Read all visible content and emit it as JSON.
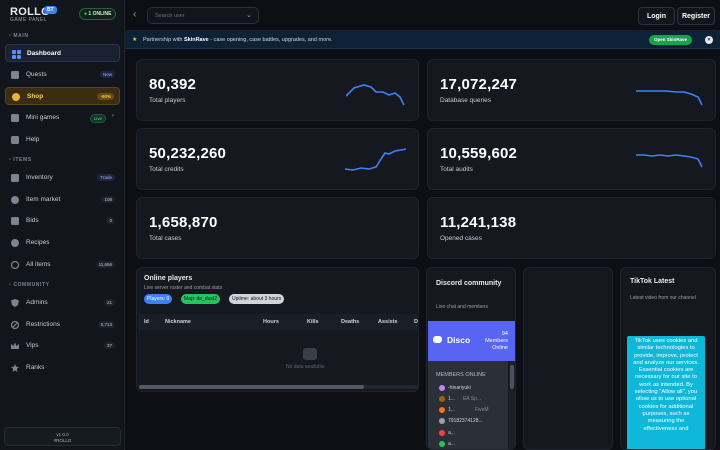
{
  "brand": {
    "name": "ROLLG",
    "version_badge": "BT",
    "sub": "GAME PANEL",
    "online": "1 ONLINE"
  },
  "sidebar": {
    "sections": [
      {
        "label": "MAIN"
      },
      {
        "label": "ITEMS"
      },
      {
        "label": "COMMUNITY"
      }
    ],
    "items": [
      {
        "label": "Dashboard",
        "icon": "grid-icon"
      },
      {
        "label": "Quests",
        "badge": "New",
        "icon": "scroll-icon"
      },
      {
        "label": "Shop",
        "badge": "-90%",
        "icon": "shop-icon"
      },
      {
        "label": "Mini games",
        "badge": "Live",
        "icon": "gamepad-icon"
      },
      {
        "label": "Help",
        "icon": "help-icon"
      },
      {
        "label": "Inventory",
        "badge": "Trade",
        "icon": "box-icon"
      },
      {
        "label": "Item market",
        "badge": "108",
        "icon": "tag-icon"
      },
      {
        "label": "Bids",
        "badge": "0",
        "icon": "gavel-icon"
      },
      {
        "label": "Recipes",
        "icon": "recipe-icon"
      },
      {
        "label": "All items",
        "badge": "11,656",
        "icon": "globe-icon"
      },
      {
        "label": "Admins",
        "badge": "21",
        "icon": "shield-icon"
      },
      {
        "label": "Restrictions",
        "badge": "5,713",
        "icon": "ban-icon"
      },
      {
        "label": "Vips",
        "badge": "37",
        "icon": "crown-icon"
      },
      {
        "label": "Ranks",
        "icon": "rank-icon"
      }
    ],
    "footer_version": "v1.0.0",
    "footer_tag": "#ROLLG"
  },
  "topbar": {
    "search_placeholder": "Search user",
    "login": "Login",
    "register": "Register"
  },
  "banner": {
    "prefix": "Partnership with ",
    "partner": "SkinRave",
    "suffix": " - case opening, case battles, upgrades, and more.",
    "button": "Open SkinRave"
  },
  "stats": [
    {
      "value": "80,392",
      "label": "Total players"
    },
    {
      "value": "17,072,247",
      "label": "Database queries"
    },
    {
      "value": "50,232,260",
      "label": "Total credits"
    },
    {
      "value": "10,559,602",
      "label": "Total audits"
    },
    {
      "value": "1,658,870",
      "label": "Total cases"
    },
    {
      "value": "11,241,138",
      "label": "Opened cases"
    }
  ],
  "players": {
    "title": "Online players",
    "subtitle": "Live server roster and combat stats",
    "pills": [
      "Players: 0",
      "Map: de_dust2",
      "Uptime: about 3 hours"
    ],
    "columns": [
      "Id",
      "Nickname",
      "Hours",
      "Kills",
      "Deaths",
      "Assists",
      "D"
    ],
    "empty": "No data available"
  },
  "discord": {
    "title": "Discord community",
    "subtitle": "Live chat and members",
    "widget_name": "Disco",
    "member_count": "94",
    "member_count_label": "Members Online",
    "members_heading": "MEMBERS ONLINE",
    "members": [
      {
        "name": "-hinariyuki",
        "status": ""
      },
      {
        "name": "1...",
        "status": "EA Sp..."
      },
      {
        "name": "1...",
        "status": "FiveM"
      },
      {
        "name": "79182374128...",
        "status": ""
      },
      {
        "name": "a...",
        "status": ""
      },
      {
        "name": "a...",
        "status": ""
      }
    ]
  },
  "tiktok": {
    "title": "TikTok Latest",
    "subtitle": "Latest video from our channel",
    "cookie_text": "TikTok uses cookies and similar technologies to provide, improve, protect and analyze our services. Essential cookies are necessary for our site to work as intended. By selecting \"Allow all\", you allow us to use optional cookies for additional purposes, such as measuring the effectiveness and"
  },
  "colors": {
    "accent": "#3b82f6",
    "shop": "#f4d16a",
    "live": "#4ade80",
    "discord": "#5865f2",
    "cookie": "#0fb8d8",
    "partner_button": "#16a34a"
  }
}
